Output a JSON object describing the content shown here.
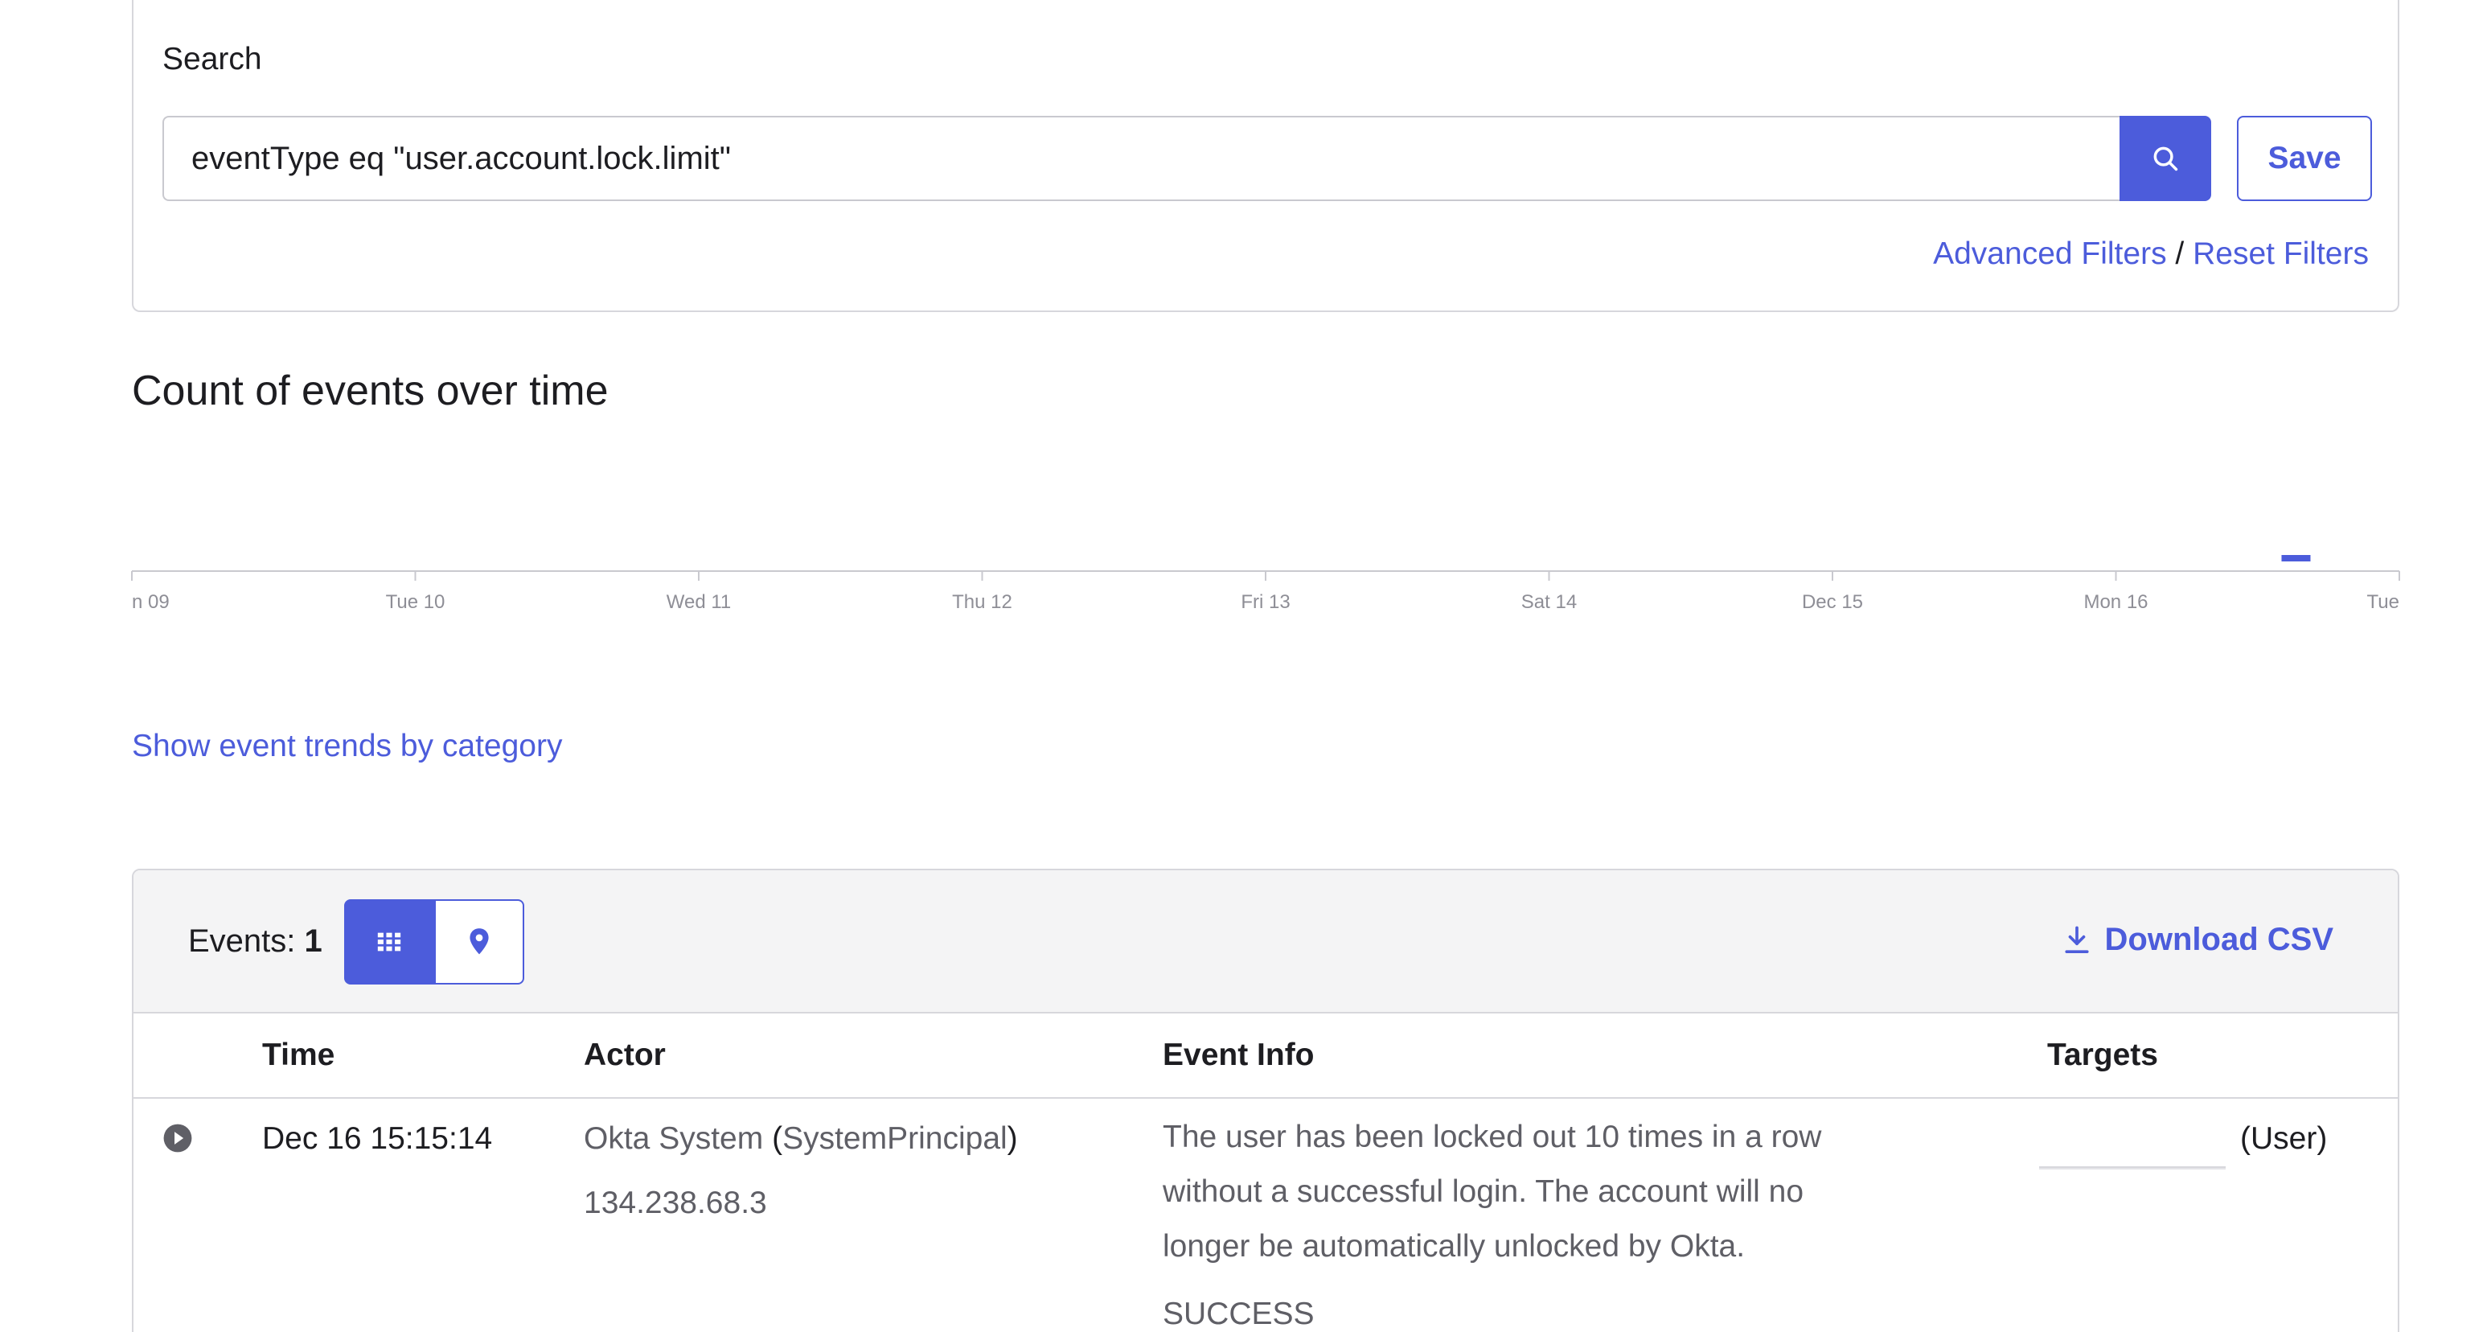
{
  "search": {
    "label": "Search",
    "query": "eventType eq \"user.account.lock.limit\"",
    "save_label": "Save",
    "advanced_filters": "Advanced Filters",
    "separator": "/",
    "reset_filters": "Reset Filters"
  },
  "chart": {
    "title": "Count of events over time"
  },
  "chart_data": {
    "type": "bar",
    "title": "Count of events over time",
    "categories": [
      "n 09",
      "Tue 10",
      "Wed 11",
      "Thu 12",
      "Fri 13",
      "Sat 14",
      "Dec 15",
      "Mon 16",
      "Tue"
    ],
    "x_ticks": [
      "n 09",
      "Tue 10",
      "Wed 11",
      "Thu 12",
      "Fri 13",
      "Sat 14",
      "Dec 15",
      "Mon 16",
      "Tue"
    ],
    "bars": [
      {
        "x": "Dec 16 15:15",
        "value": 1
      }
    ],
    "xlabel": "",
    "ylabel": "",
    "grid": false,
    "legend": "none"
  },
  "trends": {
    "link_text": "Show event trends by category"
  },
  "events": {
    "count_label": "Events:",
    "count_value": "1",
    "download_label": "Download CSV",
    "columns": [
      "Time",
      "Actor",
      "Event Info",
      "Targets"
    ],
    "rows": [
      {
        "time": "Dec 16 15:15:14",
        "actor_name": "Okta System",
        "actor_type": "SystemPrincipal",
        "actor_ip": "134.238.68.3",
        "event_info_lines": [
          "The user has been locked out 10 times in a row",
          "without a successful login. The account will no",
          "longer be automatically unlocked by Okta."
        ],
        "outcome": "SUCCESS",
        "target_type": "(User)"
      }
    ]
  },
  "colors": {
    "accent": "#4c5cdb",
    "border": "#d7d7dc",
    "header_bg": "#f4f4f5",
    "axis": "#c9c9cf",
    "tick_text": "#8e8e96"
  },
  "icons": {
    "search": "search-icon",
    "grid": "grid-icon",
    "map": "map-pin-icon",
    "download": "download-icon",
    "expand": "chevron-right-circle-icon"
  }
}
